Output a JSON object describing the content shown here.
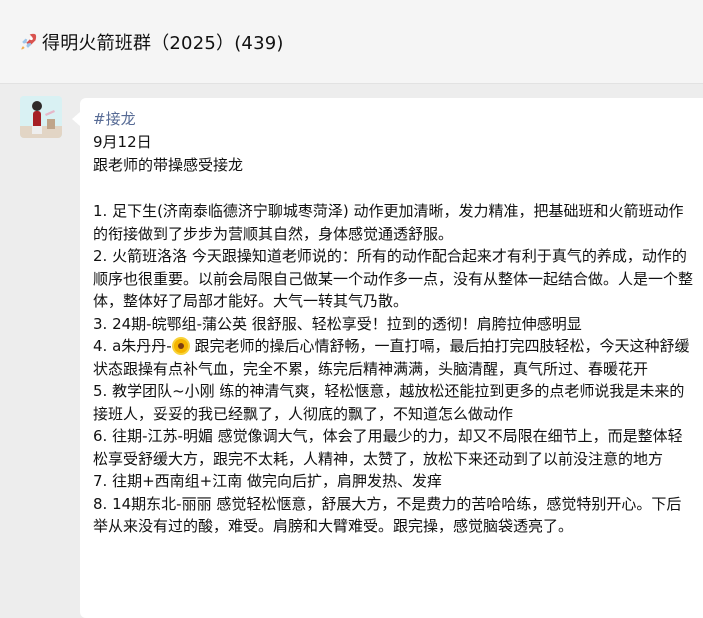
{
  "header": {
    "title": "得明火箭班群（2025）(439)",
    "icon": "rocket-icon"
  },
  "message": {
    "hashtag": "#接龙",
    "date": "9月12日",
    "subtitle": "跟老师的带操感受接龙",
    "items": [
      "1. 足下生(济南泰临德济宁聊城枣菏泽) 动作更加清晰，发力精准，把基础班和火箭班动作的衔接做到了步步为营顺其自然，身体感觉通透舒服。",
      "2. 火箭班洛洛 今天跟操知道老师说的：所有的动作配合起来才有利于真气的养成，动作的顺序也很重要。以前会局限自己做某一个动作多一点，没有从整体一起结合做。人是一个整体，整体好了局部才能好。大气一转其气乃散。",
      "3. 24期-皖鄂组-蒲公英 很舒服、轻松享受！拉到的透彻！肩胯拉伸感明显",
      "4. a朱丹丹-",
      " 跟完老师的操后心情舒畅，一直打嗝，最后拍打完四肢轻松，今天这种舒缓状态跟操有点补气血，完全不累，练完后精神满满，头脑清醒，真气所过、春暖花开",
      "5. 教学团队~小刚 练的神清气爽，轻松惬意，越放松还能拉到更多的点老师说我是未来的接班人，妥妥的我已经飘了，人彻底的飘了，不知道怎么做动作",
      "6. 往期-江苏-明媚 感觉像调大气，体会了用最少的力，却又不局限在细节上，而是整体轻松享受舒缓大方，跟完不太耗，人精神，太赞了，放松下来还动到了以前没注意的地方",
      "7. 往期+西南组+江南 做完向后扩，肩胛发热、发痒",
      "8. 14期东北-丽丽  感觉轻松惬意，舒展大方，不是费力的苦哈哈练，感觉特别开心。下后举从来没有过的酸，难受。肩膀和大臂难受。跟完操，感觉脑袋透亮了。"
    ],
    "sun_icon": "sunflower-icon"
  }
}
